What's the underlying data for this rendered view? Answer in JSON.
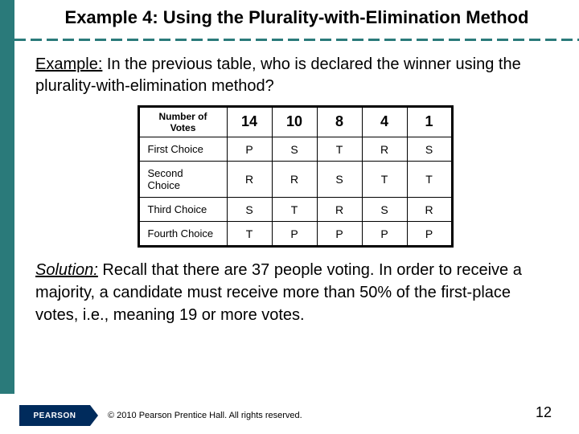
{
  "title": "Example 4: Using the Plurality-with-Elimination Method",
  "example": {
    "label": "Example:",
    "text": " In the previous table, who is declared the winner using the plurality-with-elimination method?"
  },
  "chart_data": {
    "type": "table",
    "header_label": "Number of Votes",
    "columns": [
      "14",
      "10",
      "8",
      "4",
      "1"
    ],
    "rows": [
      {
        "label": "First Choice",
        "cells": [
          "P",
          "S",
          "T",
          "R",
          "S"
        ]
      },
      {
        "label": "Second Choice",
        "cells": [
          "R",
          "R",
          "S",
          "T",
          "T"
        ]
      },
      {
        "label": "Third Choice",
        "cells": [
          "S",
          "T",
          "R",
          "S",
          "R"
        ]
      },
      {
        "label": "Fourth Choice",
        "cells": [
          "T",
          "P",
          "P",
          "P",
          "P"
        ]
      }
    ]
  },
  "solution": {
    "label": "Solution:",
    "text": " Recall that there are 37 people voting. In order to receive a majority, a candidate must receive more than 50% of the first-place votes, i.e., meaning 19 or more votes."
  },
  "footer": {
    "logo": "PEARSON",
    "copyright": "© 2010 Pearson Prentice Hall. All rights reserved.",
    "page": "12"
  }
}
